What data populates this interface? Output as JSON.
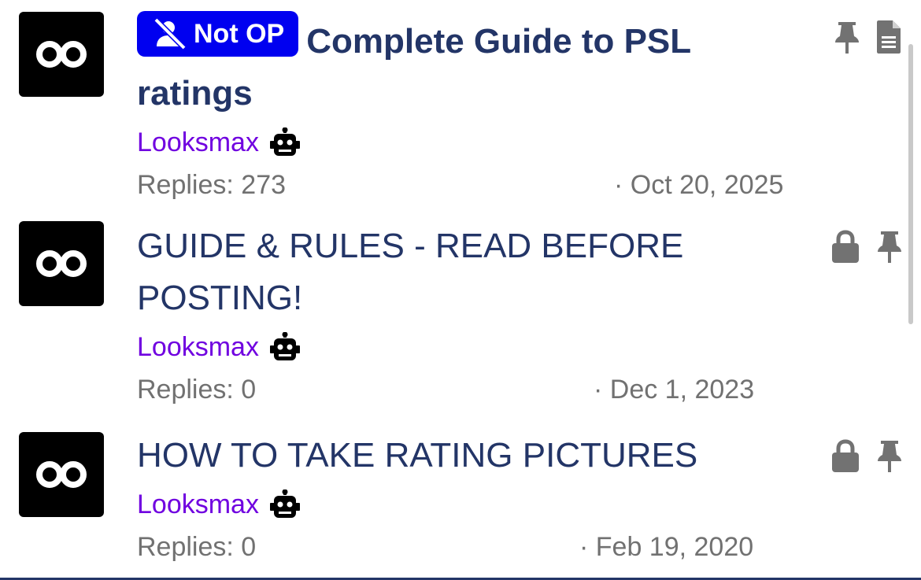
{
  "threads": [
    {
      "label": "Not OP",
      "title": "Complete Guide to PSL ratings",
      "author": "Looksmax",
      "replies": "Replies: 273",
      "date": "· Oct 20, 2025",
      "status_icons": [
        "pin-icon",
        "document-icon"
      ]
    },
    {
      "title": "GUIDE & RULES - READ BEFORE POSTING!",
      "author": "Looksmax",
      "replies": "Replies: 0",
      "date": "· Dec 1, 2023",
      "status_icons": [
        "lock-icon",
        "pin-icon"
      ]
    },
    {
      "title": "HOW TO TAKE RATING PICTURES",
      "author": "Looksmax",
      "replies": "Replies: 0",
      "date": "· Feb 19, 2020",
      "status_icons": [
        "lock-icon",
        "pin-icon"
      ]
    }
  ],
  "colors": {
    "title": "#233567",
    "author": "#7000e0",
    "meta": "#717171",
    "label_bg": "#0000f0",
    "icon_gray": "#727272"
  }
}
